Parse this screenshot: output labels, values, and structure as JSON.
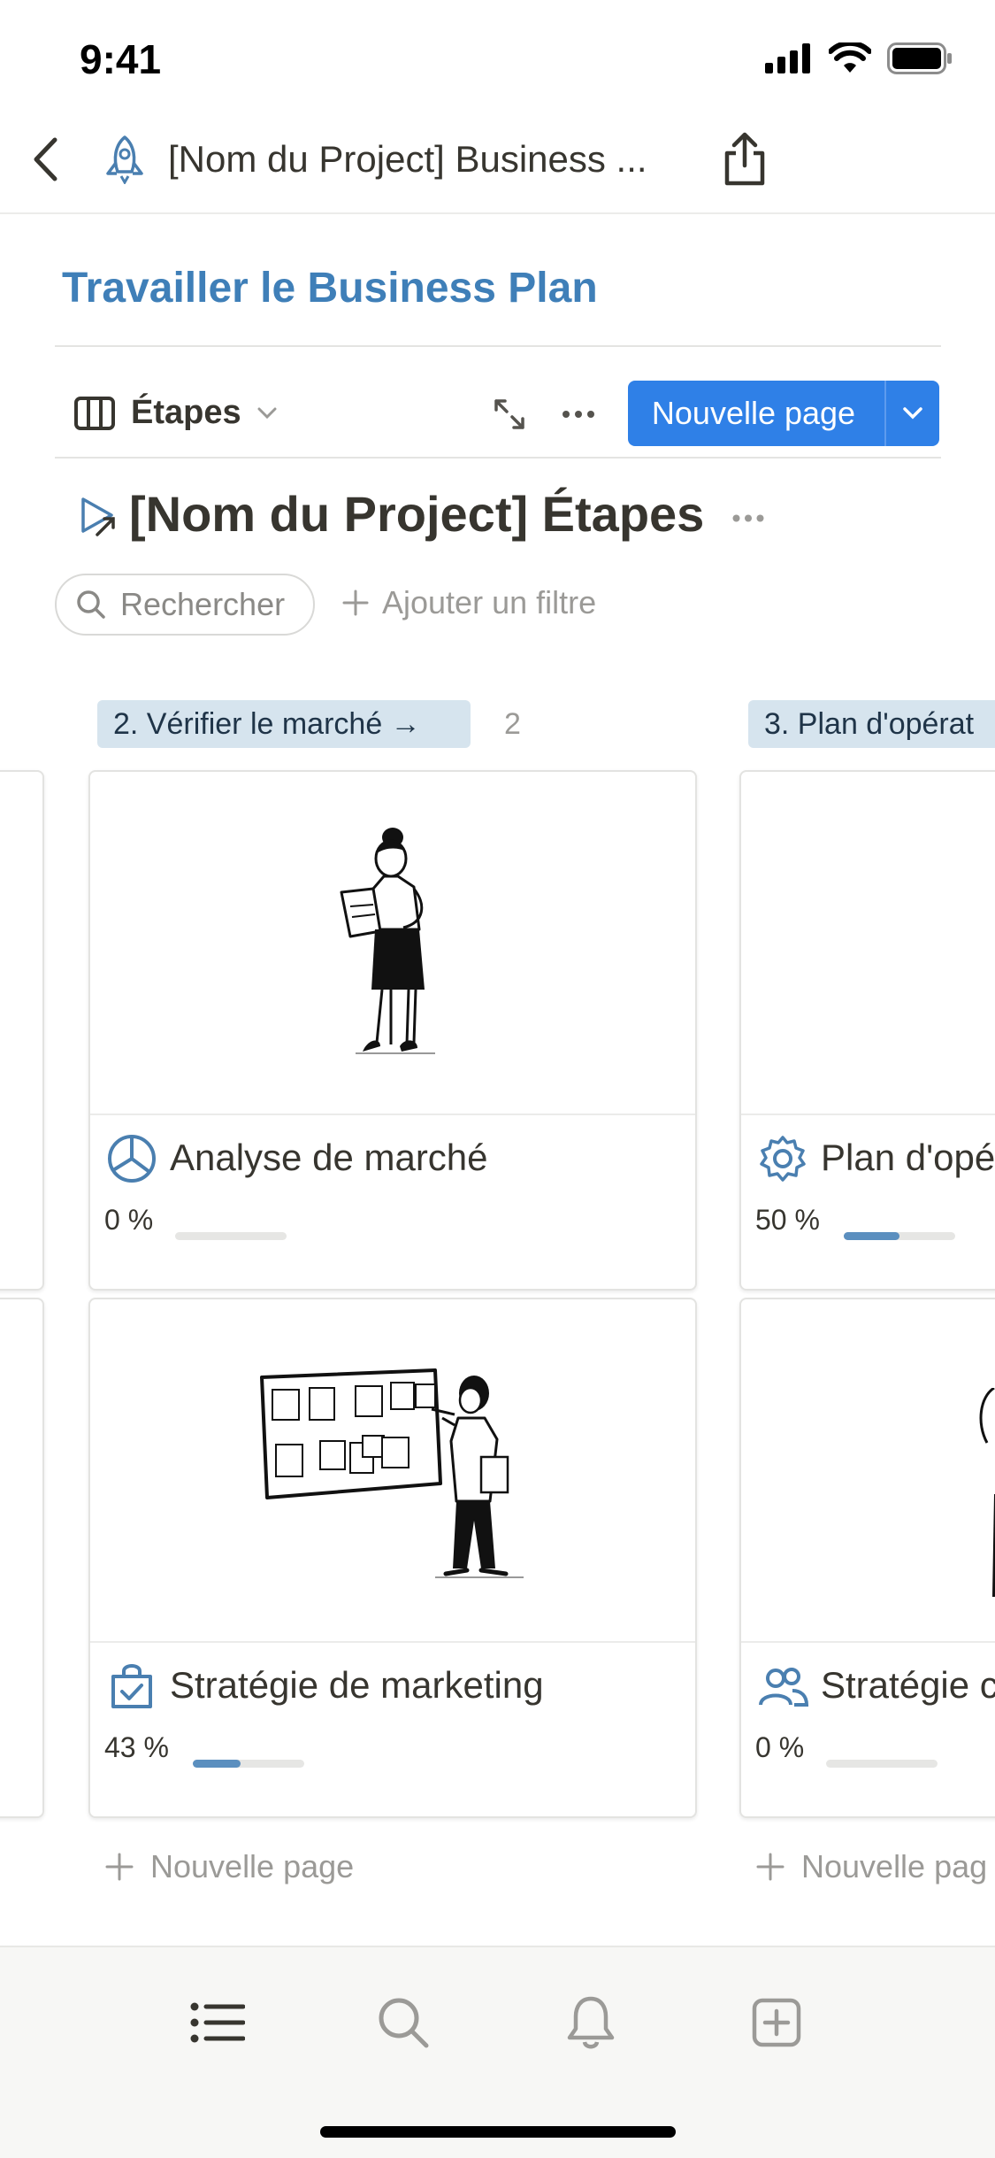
{
  "status_bar": {
    "time": "9:41"
  },
  "nav": {
    "title": "[Nom du Project] Business ..."
  },
  "page": {
    "heading": "Travailler le Business Plan"
  },
  "toolbar": {
    "view_label": "Étapes",
    "new_page_label": "Nouvelle page"
  },
  "database": {
    "title": "[Nom du Project] Étapes",
    "search_placeholder": "Rechercher",
    "add_filter_label": "Ajouter un filtre"
  },
  "board": {
    "groups": [
      {
        "label": "2. Vérifier le marché →",
        "count": "2",
        "cards": [
          {
            "title": "Analyse de marché",
            "progress_label": "0 %",
            "progress": 0,
            "icon": "pie-chart-icon"
          },
          {
            "title": "Stratégie de marketing",
            "progress_label": "43 %",
            "progress": 0.43,
            "icon": "shopping-bag-check-icon"
          }
        ],
        "add_label": "Nouvelle page"
      },
      {
        "label": "3. Plan d'opérat",
        "cards": [
          {
            "title": "Plan d'opé",
            "progress_label": "50 %",
            "progress": 0.5,
            "icon": "gear-icon"
          },
          {
            "title": "Stratégie c",
            "progress_label": "0 %",
            "progress": 0,
            "icon": "people-icon"
          }
        ],
        "add_label": "Nouvelle pag"
      }
    ]
  },
  "tab_bar": {
    "items": [
      "list-icon",
      "search-icon",
      "bell-icon",
      "new-page-icon"
    ]
  },
  "colors": {
    "accent": "#2f80e7",
    "heading_blue": "#3f7fb8",
    "tag_bg": "#d6e4ee",
    "progress_fill": "#5b8fbf"
  }
}
